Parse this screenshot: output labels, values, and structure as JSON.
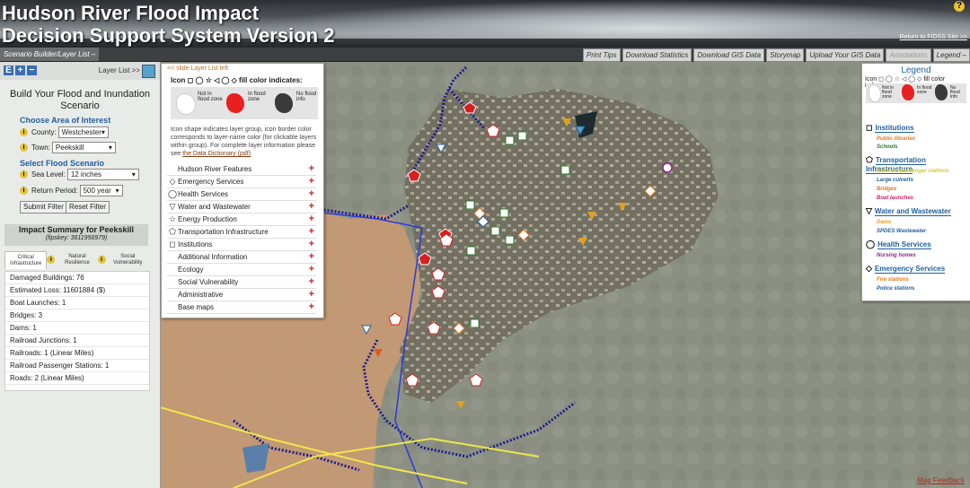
{
  "header": {
    "title_line1": "Hudson River Flood Impact",
    "title_line2": "Decision Support System Version 2",
    "return_link": "Return to FIDSS Site >>",
    "help_icon": "question-icon"
  },
  "toolbar": {
    "scenario_builder": "Scenario Builder/Layer List –",
    "buttons": [
      "Print Tips",
      "Download Statistics",
      "Download GIS Data",
      "Storymap",
      "Upload Your GIS Data",
      "Annotations",
      "Legend –"
    ]
  },
  "sidebar": {
    "layer_list_link": "Layer List >>",
    "zoom_buttons": [
      "E",
      "+",
      "−"
    ],
    "build_title": "Build Your Flood and Inundation Scenario",
    "area_header": "Choose Area of Interest",
    "county_label": "County:",
    "county_value": "Westchester",
    "town_label": "Town:",
    "town_value": "Peekskill",
    "scenario_header": "Select Flood Scenario",
    "sea_level_label": "Sea Level:",
    "sea_level_value": "12 inches",
    "return_period_label": "Return Period:",
    "return_period_value": "500 year",
    "submit_button": "Submit Filter",
    "reset_button": "Reset Filter",
    "impact_title": "Impact Summary for Peekskill",
    "impact_subtitle": "(fipskey: 3611956979)",
    "tabs": [
      "Critical Infrastructure",
      "Natural Resilience",
      "Social Vulnerability"
    ],
    "impact_rows": [
      "Damaged Buildings: 76",
      "Estimated Loss: 11601884 ($)",
      "Boat Launches: 1",
      "Bridges: 3",
      "Dams: 1",
      "Railroad Junctions: 1",
      "Railroads: 1 (Linear Miles)",
      "Railroad Passenger Stations: 1",
      "Roads: 2 (Linear Miles)"
    ]
  },
  "layer_panel": {
    "slide_link": "<< slide Layer List left",
    "icon_header": "Icon ◻ ◯ ☆ ◁ ◯ ◇ fill color indicates:",
    "fill_items": [
      "Not in flood zone",
      "In flood zone",
      "No flood info"
    ],
    "description_text": "Icon shape indicates layer group, icon border color corresponds to layer-name color (for clickable layers within group). For complete layer information please see ",
    "description_link": "the Data Dictionary (pdf)",
    "layers": [
      {
        "sym": "",
        "label": "Hudson River Features"
      },
      {
        "sym": "◇",
        "label": "Emergency Services"
      },
      {
        "sym": "◯",
        "label": "Health Services"
      },
      {
        "sym": "▽",
        "label": "Water and Wastewater"
      },
      {
        "sym": "☆",
        "label": "Energy Production"
      },
      {
        "sym": "⬠",
        "label": "Transportation Infrastructure"
      },
      {
        "sym": "◻",
        "label": "Institutions"
      },
      {
        "sym": "",
        "label": "Additional Information"
      },
      {
        "sym": "",
        "label": "Ecology"
      },
      {
        "sym": "",
        "label": "Social Vulnerability"
      },
      {
        "sym": "",
        "label": "Administrative"
      },
      {
        "sym": "",
        "label": "Base maps"
      }
    ]
  },
  "legend": {
    "title": "Legend",
    "icon_header": "Icon ◻ ◯ ☆ ◁ ◯ ◇ fill color indicates:",
    "fill_items": [
      "Not in flood zone",
      "In flood zone",
      "No flood info"
    ],
    "categories": [
      {
        "sym": "◻",
        "name": "Institutions",
        "items": [
          {
            "label": "Public libraries",
            "color": "#e07a1f"
          },
          {
            "label": "Schools",
            "color": "#2a7a2a"
          }
        ]
      },
      {
        "sym": "⬠",
        "name": "Transportation Infrastructure",
        "items": [
          {
            "label": "Railroad passenger stations",
            "color": "#d9c81a"
          },
          {
            "label": "Large culverts",
            "color": "#1f5f9f"
          },
          {
            "label": "Bridges",
            "color": "#e07a1f"
          },
          {
            "label": "Boat launches",
            "color": "#d21f5a"
          }
        ]
      },
      {
        "sym": "▽",
        "name": "Water and Wastewater",
        "items": [
          {
            "label": "Dams",
            "color": "#e0a01f"
          },
          {
            "label": "SPDES Wastewater",
            "color": "#1f5f9f"
          }
        ]
      },
      {
        "sym": "◯",
        "name": "Health Services",
        "items": [
          {
            "label": "Nursing homes",
            "color": "#8a2a8a"
          }
        ]
      },
      {
        "sym": "◇",
        "name": "Emergency Services",
        "items": [
          {
            "label": "Fire stations",
            "color": "#e07a1f"
          },
          {
            "label": "Police stations",
            "color": "#1f5f9f"
          }
        ]
      }
    ]
  },
  "map": {
    "feedback_link": "Map Feedback"
  }
}
